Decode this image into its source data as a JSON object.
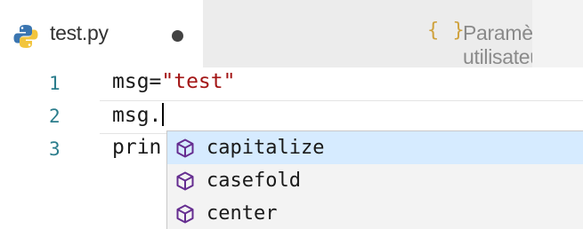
{
  "tabs": {
    "active": {
      "label": "test.py",
      "icon": "python-icon",
      "dirty": true
    },
    "inactive": {
      "label": "Paramètres utilisateur",
      "icon": "braces-icon",
      "icon_text": "{ }"
    }
  },
  "editor": {
    "lines": [
      {
        "number": "1",
        "code_prefix": "msg=",
        "code_string": "\"test\""
      },
      {
        "number": "2",
        "code_prefix": "msg.",
        "code_string": ""
      },
      {
        "number": "3",
        "code_prefix": "prin",
        "code_string": ""
      }
    ]
  },
  "suggestions": [
    {
      "label": "capitalize",
      "icon": "method-icon",
      "selected": true
    },
    {
      "label": "casefold",
      "icon": "method-icon",
      "selected": false
    },
    {
      "label": "center",
      "icon": "method-icon",
      "selected": false
    }
  ],
  "colors": {
    "line_number": "#2b7d8c",
    "string": "#a31515",
    "selected_suggestion": "#d6ebff",
    "method_icon": "#652d90",
    "braces_icon": "#cfa23e"
  }
}
